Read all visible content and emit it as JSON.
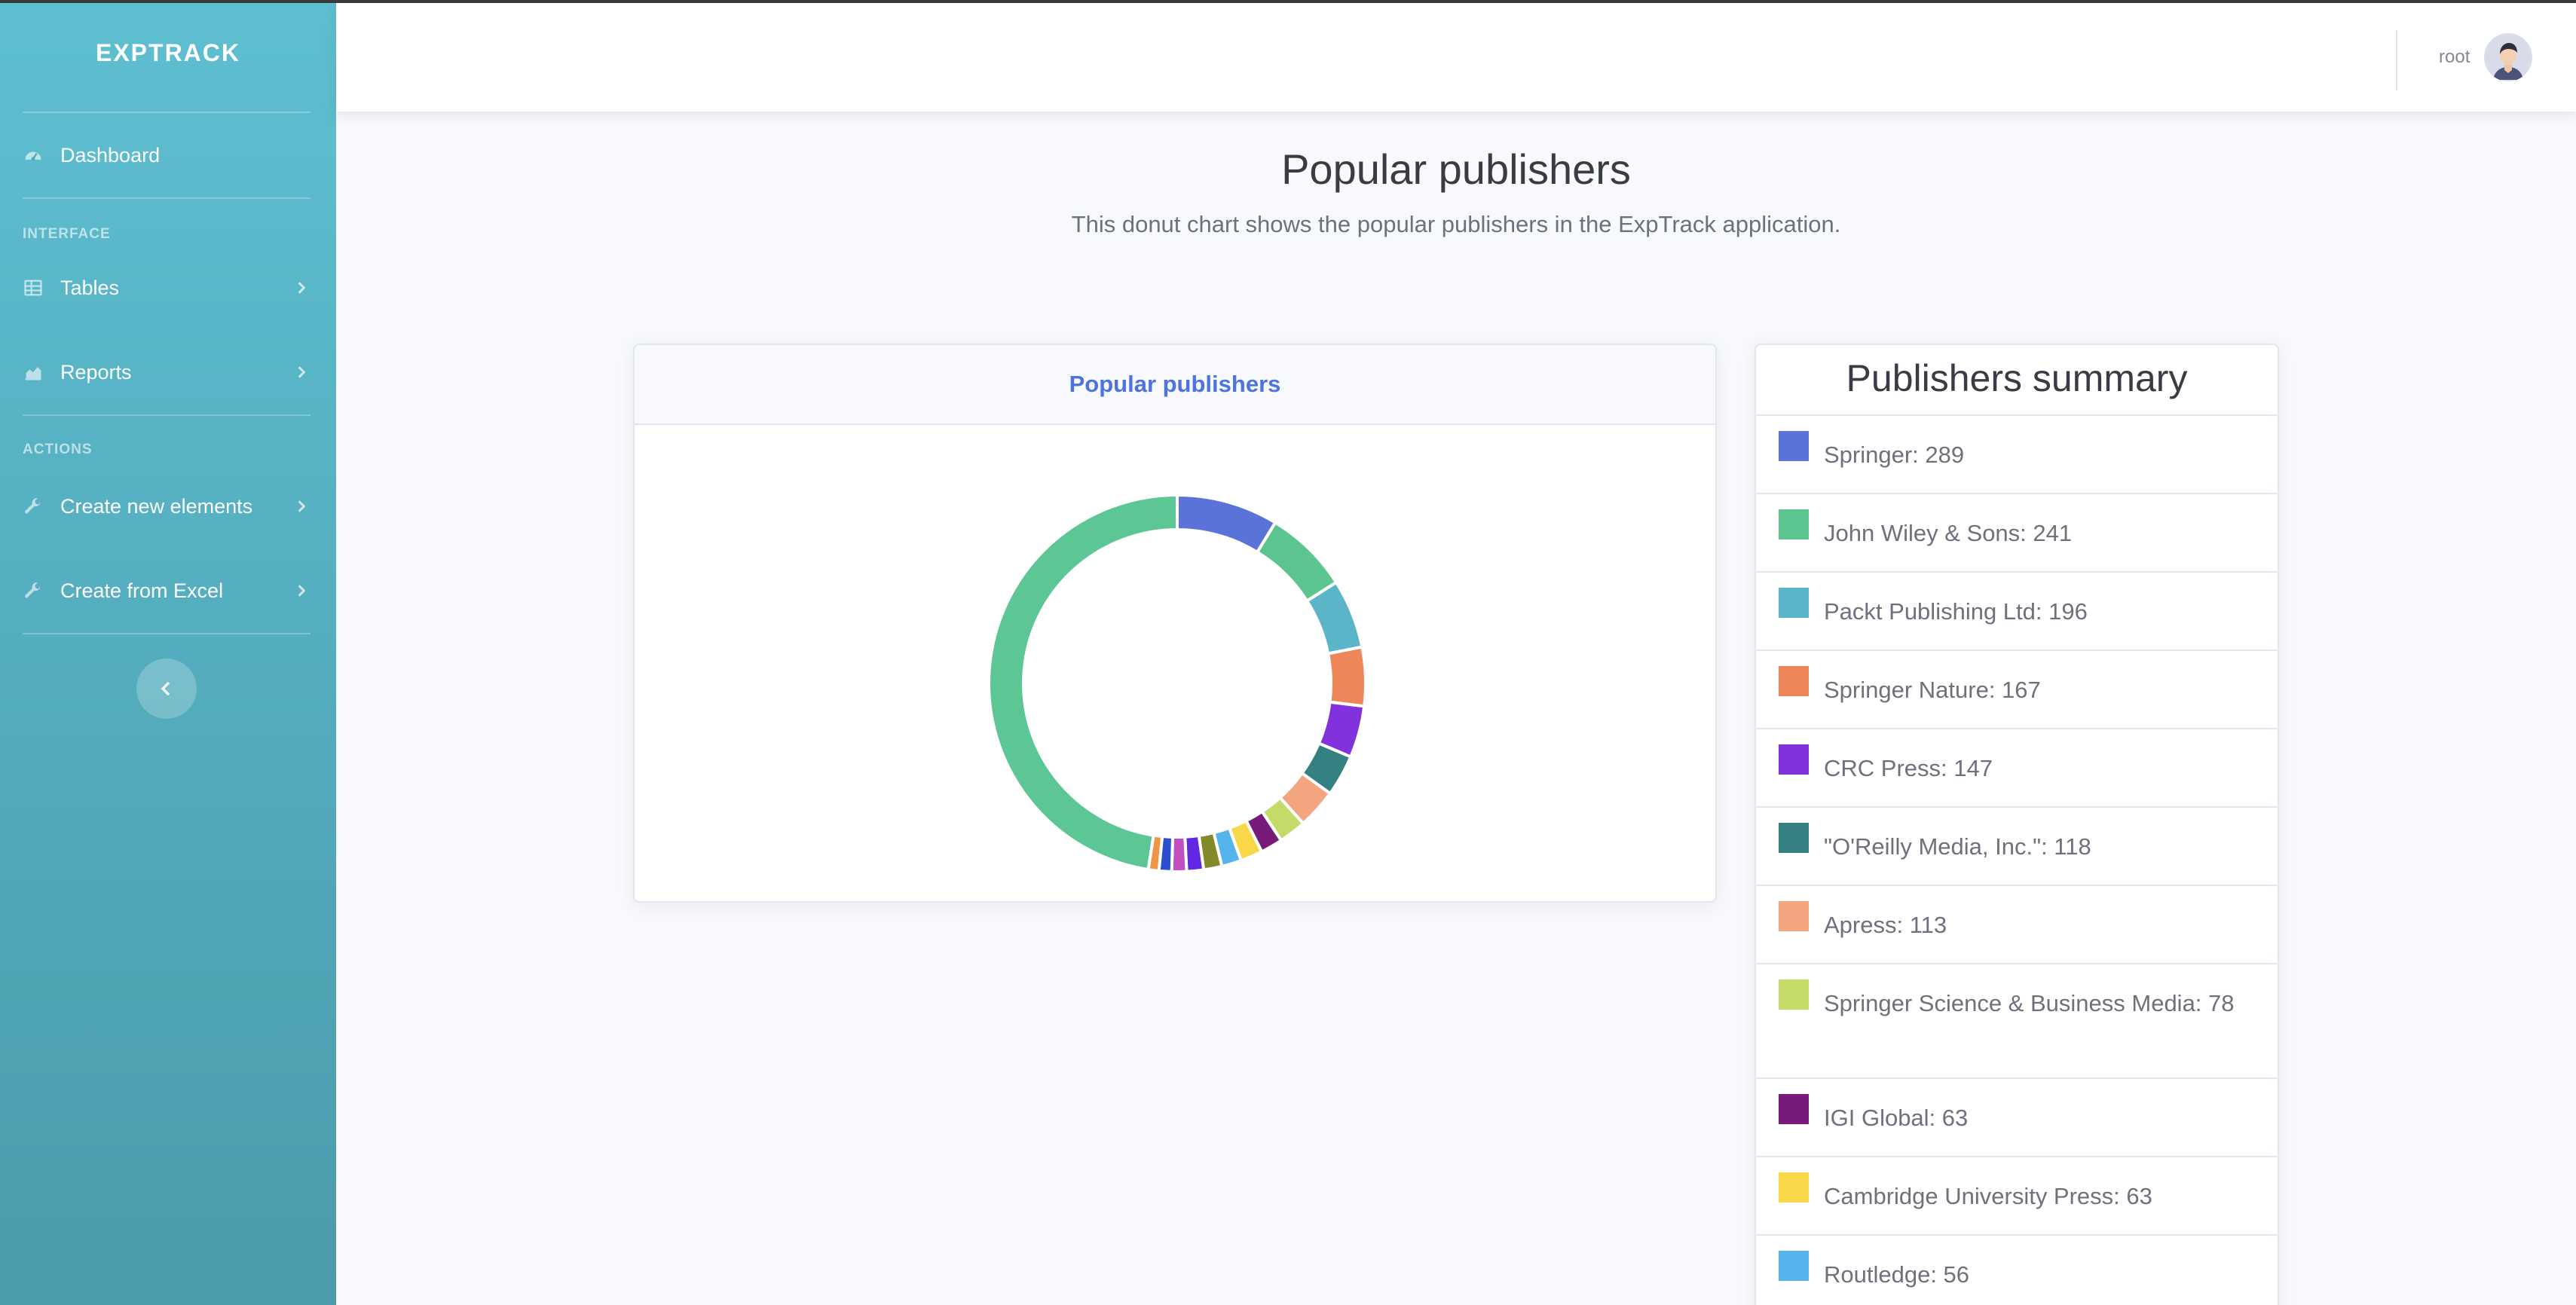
{
  "sidebar": {
    "brand": "EXPTRACK",
    "dashboard": "Dashboard",
    "heading_interface": "INTERFACE",
    "tables": "Tables",
    "reports": "Reports",
    "heading_actions": "ACTIONS",
    "create_new": "Create new elements",
    "create_excel": "Create from Excel"
  },
  "topbar": {
    "username": "root"
  },
  "page": {
    "title": "Popular publishers",
    "subtitle": "This donut chart shows the popular publishers in the ExpTrack application."
  },
  "chart_card": {
    "header": "Popular publishers"
  },
  "summary": {
    "title": "Publishers summary",
    "items": [
      {
        "label": "Springer: 289",
        "color": "#5a73d8"
      },
      {
        "label": "John Wiley & Sons: 241",
        "color": "#5cc58f"
      },
      {
        "label": "Packt Publishing Ltd: 196",
        "color": "#5ab5c8"
      },
      {
        "label": "Springer Nature: 167",
        "color": "#ee8659"
      },
      {
        "label": "CRC Press: 147",
        "color": "#8132dc"
      },
      {
        "label": "\"O'Reilly Media, Inc.\": 118",
        "color": "#358080"
      },
      {
        "label": "Apress: 113",
        "color": "#f2a57f"
      },
      {
        "label": "Springer Science & Business Media: 78",
        "color": "#c4db6a"
      },
      {
        "label": "IGI Global: 63",
        "color": "#771a7a"
      },
      {
        "label": "Cambridge University Press: 63",
        "color": "#f8d849"
      },
      {
        "label": "Routledge: 56",
        "color": "#56b4ec"
      }
    ]
  },
  "chart_data": {
    "type": "pie",
    "donut": true,
    "title": "Popular publishers",
    "categories": [
      "Springer",
      "John Wiley & Sons",
      "Packt Publishing Ltd",
      "Springer Nature",
      "CRC Press",
      "\"O'Reilly Media, Inc.\"",
      "Apress",
      "Springer Science & Business Media",
      "IGI Global",
      "Cambridge University Press",
      "Routledge",
      "(unlabeled)",
      "(unlabeled)",
      "(unlabeled)",
      "(unlabeled)",
      "(unlabeled)",
      "(unlabeled)"
    ],
    "values": [
      289,
      241,
      196,
      167,
      147,
      118,
      113,
      78,
      63,
      63,
      56,
      52,
      48,
      42,
      36,
      30,
      1576
    ],
    "colors": [
      "#5a73d8",
      "#5cc58f",
      "#5ab5c8",
      "#ee8659",
      "#8132dc",
      "#358080",
      "#f2a57f",
      "#c4db6a",
      "#771a7a",
      "#f8d849",
      "#56b4ec",
      "#838a2c",
      "#6127e3",
      "#c24fbf",
      "#2b4ed3",
      "#ef9545",
      "#5dc695"
    ]
  }
}
